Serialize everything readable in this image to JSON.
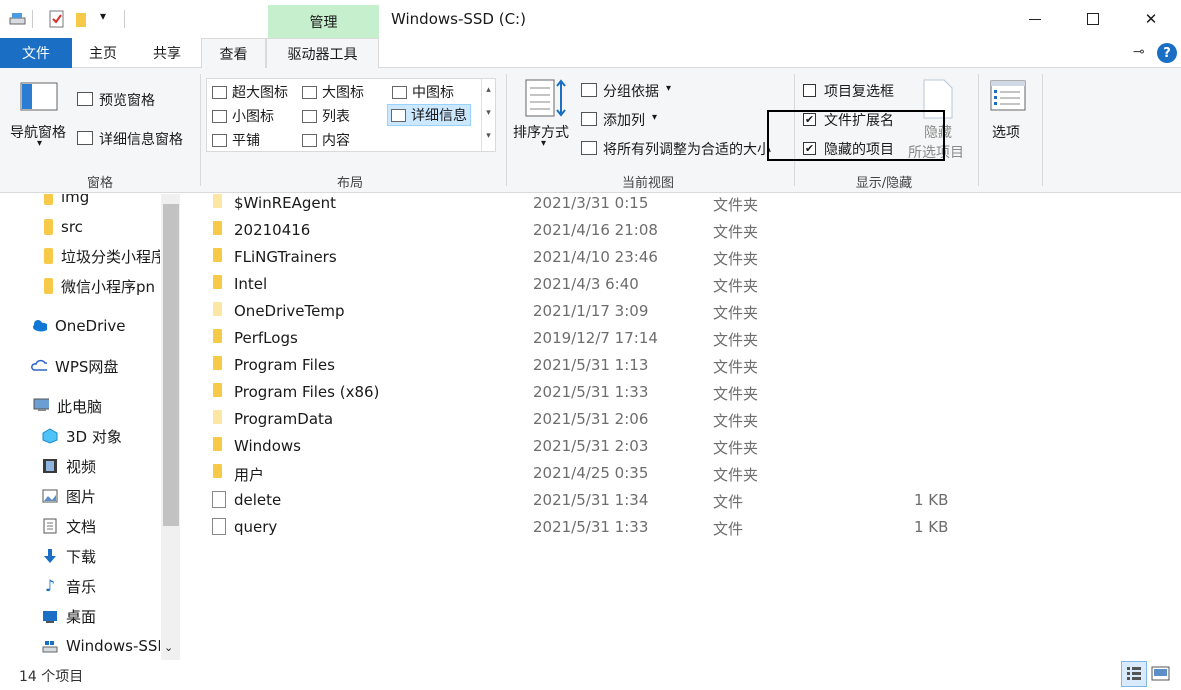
{
  "titlebar": {
    "manage_tab": "管理",
    "window_title": "Windows-SSD (C:)",
    "minimize": "—",
    "maximize": "☐",
    "close": "✕"
  },
  "tabs": {
    "file": "文件",
    "home": "主页",
    "share": "共享",
    "view": "查看",
    "drive_tools": "驱动器工具"
  },
  "ribbon": {
    "pane_group": {
      "nav_pane": "导航窗格",
      "preview_pane": "预览窗格",
      "details_pane": "详细信息窗格",
      "label": "窗格"
    },
    "layout_group": {
      "label": "布局",
      "items": [
        "超大图标",
        "大图标",
        "中图标",
        "小图标",
        "列表",
        "详细信息",
        "平铺",
        "内容"
      ],
      "selected": "详细信息"
    },
    "current_view_group": {
      "sort_by": "排序方式",
      "group_by": "分组依据",
      "add_column": "添加列",
      "fit_columns": "将所有列调整为合适的大小",
      "label": "当前视图"
    },
    "show_hide_group": {
      "item_checkboxes": "项目复选框",
      "item_checkboxes_checked": false,
      "file_extensions": "文件扩展名",
      "file_extensions_checked": true,
      "hidden_items": "隐藏的项目",
      "hidden_items_checked": true,
      "hide_selected_line1": "隐藏",
      "hide_selected_line2": "所选项目",
      "label": "显示/隐藏"
    },
    "options": "选项"
  },
  "nav": {
    "items": [
      "img",
      "src",
      "垃圾分类小程序",
      "微信小程序pn",
      "OneDrive",
      "WPS网盘",
      "此电脑",
      "3D 对象",
      "视频",
      "图片",
      "文档",
      "下载",
      "音乐",
      "桌面",
      "Windows-SSD"
    ]
  },
  "files": [
    {
      "name": "$WinREAgent",
      "date": "2021/3/31 0:15",
      "type": "文件夹",
      "size": "",
      "kind": "folder-light"
    },
    {
      "name": "20210416",
      "date": "2021/4/16 21:08",
      "type": "文件夹",
      "size": "",
      "kind": "folder"
    },
    {
      "name": "FLiNGTrainers",
      "date": "2021/4/10 23:46",
      "type": "文件夹",
      "size": "",
      "kind": "folder"
    },
    {
      "name": "Intel",
      "date": "2021/4/3 6:40",
      "type": "文件夹",
      "size": "",
      "kind": "folder"
    },
    {
      "name": "OneDriveTemp",
      "date": "2021/1/17 3:09",
      "type": "文件夹",
      "size": "",
      "kind": "folder-light"
    },
    {
      "name": "PerfLogs",
      "date": "2019/12/7 17:14",
      "type": "文件夹",
      "size": "",
      "kind": "folder"
    },
    {
      "name": "Program Files",
      "date": "2021/5/31 1:13",
      "type": "文件夹",
      "size": "",
      "kind": "folder"
    },
    {
      "name": "Program Files (x86)",
      "date": "2021/5/31 1:33",
      "type": "文件夹",
      "size": "",
      "kind": "folder"
    },
    {
      "name": "ProgramData",
      "date": "2021/5/31 2:06",
      "type": "文件夹",
      "size": "",
      "kind": "folder-light"
    },
    {
      "name": "Windows",
      "date": "2021/5/31 2:03",
      "type": "文件夹",
      "size": "",
      "kind": "folder"
    },
    {
      "name": "用户",
      "date": "2021/4/25 0:35",
      "type": "文件夹",
      "size": "",
      "kind": "folder"
    },
    {
      "name": "delete",
      "date": "2021/5/31 1:34",
      "type": "文件",
      "size": "1 KB",
      "kind": "file"
    },
    {
      "name": "query",
      "date": "2021/5/31 1:33",
      "type": "文件",
      "size": "1 KB",
      "kind": "file"
    }
  ],
  "status": {
    "count": "14 个项目"
  },
  "colors": {
    "file_tab": "#1a6fc4",
    "manage_tab": "#c6efce",
    "selection": "#cce8ff",
    "folder": "#f7c948"
  }
}
